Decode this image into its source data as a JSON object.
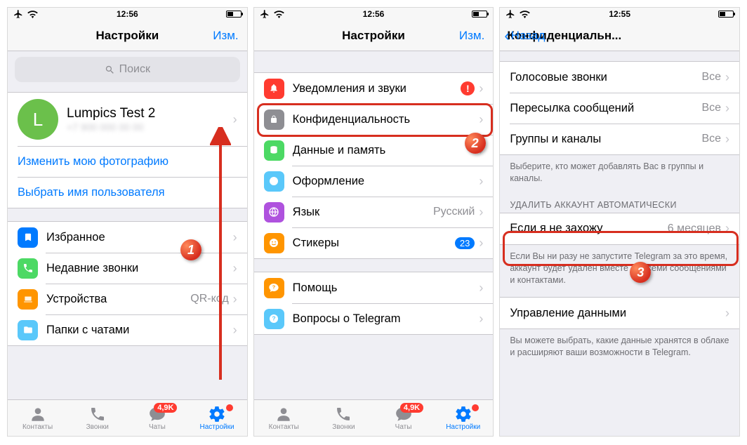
{
  "status": {
    "time1": "12:56",
    "time2": "12:56",
    "time3": "12:55"
  },
  "screen1": {
    "title": "Настройки",
    "edit": "Изм.",
    "search_placeholder": "Поиск",
    "profile_initial": "L",
    "profile_name": "Lumpics Test 2",
    "profile_sub": "+7 900 000 00 00",
    "change_photo": "Изменить мою фотографию",
    "choose_username": "Выбрать имя пользователя",
    "favorites": "Избранное",
    "recent_calls": "Недавние звонки",
    "devices": "Устройства",
    "devices_value": "QR-код",
    "folders": "Папки с чатами"
  },
  "screen2": {
    "title": "Настройки",
    "edit": "Изм.",
    "notifications": "Уведомления и звуки",
    "privacy": "Конфиденциальность",
    "data": "Данные и память",
    "appearance": "Оформление",
    "language": "Язык",
    "language_value": "Русский",
    "stickers": "Стикеры",
    "stickers_badge": "23",
    "help": "Помощь",
    "faq": "Вопросы о Telegram"
  },
  "screen3": {
    "back": "Назад",
    "title": "Конфиденциальн...",
    "voice_calls": "Голосовые звонки",
    "voice_calls_value": "Все",
    "forwarding": "Пересылка сообщений",
    "forwarding_value": "Все",
    "groups": "Группы и каналы",
    "groups_value": "Все",
    "groups_footer": "Выберите, кто может добавлять Вас в группы и каналы.",
    "delete_header": "УДАЛИТЬ АККАУНТ АВТОМАТИЧЕСКИ",
    "if_away": "Если я не захожу",
    "if_away_value": "6 месяцев",
    "if_away_footer": "Если Вы ни разу не запустите Telegram за это время, аккаунт будет удалён вместе со всеми сообщениями и контактами.",
    "data_mgmt": "Управление данными",
    "data_mgmt_footer": "Вы можете выбрать, какие данные хранятся в облаке и расширяют ваши возможности в Telegram."
  },
  "tabs": {
    "contacts": "Контакты",
    "calls": "Звонки",
    "chats": "Чаты",
    "chats_badge": "4,9K",
    "settings": "Настройки"
  }
}
